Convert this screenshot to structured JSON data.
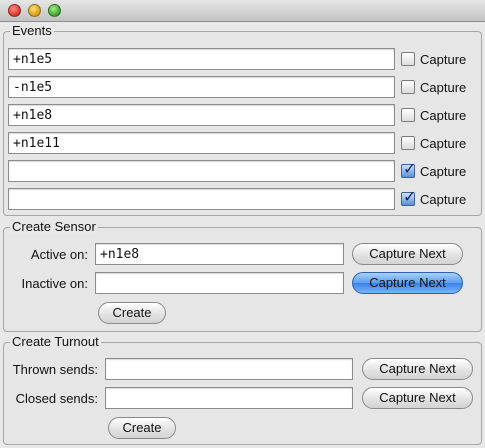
{
  "window": {
    "traffic_lights": [
      "close",
      "minimize",
      "zoom"
    ]
  },
  "events": {
    "title": "Events",
    "rows": [
      {
        "value": "+n1e5",
        "label": "Capture",
        "checked": false
      },
      {
        "value": "-n1e5",
        "label": "Capture",
        "checked": false
      },
      {
        "value": "+n1e8",
        "label": "Capture",
        "checked": false
      },
      {
        "value": "+n1e11",
        "label": "Capture",
        "checked": false
      },
      {
        "value": "",
        "label": "Capture",
        "checked": true
      },
      {
        "value": "",
        "label": "Capture",
        "checked": true
      }
    ]
  },
  "sensor": {
    "title": "Create Sensor",
    "active_label": "Active on:",
    "active_value": "+n1e8",
    "active_button": "Capture Next",
    "inactive_label": "Inactive on:",
    "inactive_value": "",
    "inactive_button": "Capture Next",
    "create_button": "Create"
  },
  "turnout": {
    "title": "Create Turnout",
    "thrown_label": "Thrown sends:",
    "thrown_value": "",
    "thrown_button": "Capture Next",
    "closed_label": "Closed sends:",
    "closed_value": "",
    "closed_button": "Capture Next",
    "create_button": "Create"
  },
  "colors": {
    "default_button": "#5a9ef0",
    "checkbox_checked": "#5c8fd6"
  }
}
